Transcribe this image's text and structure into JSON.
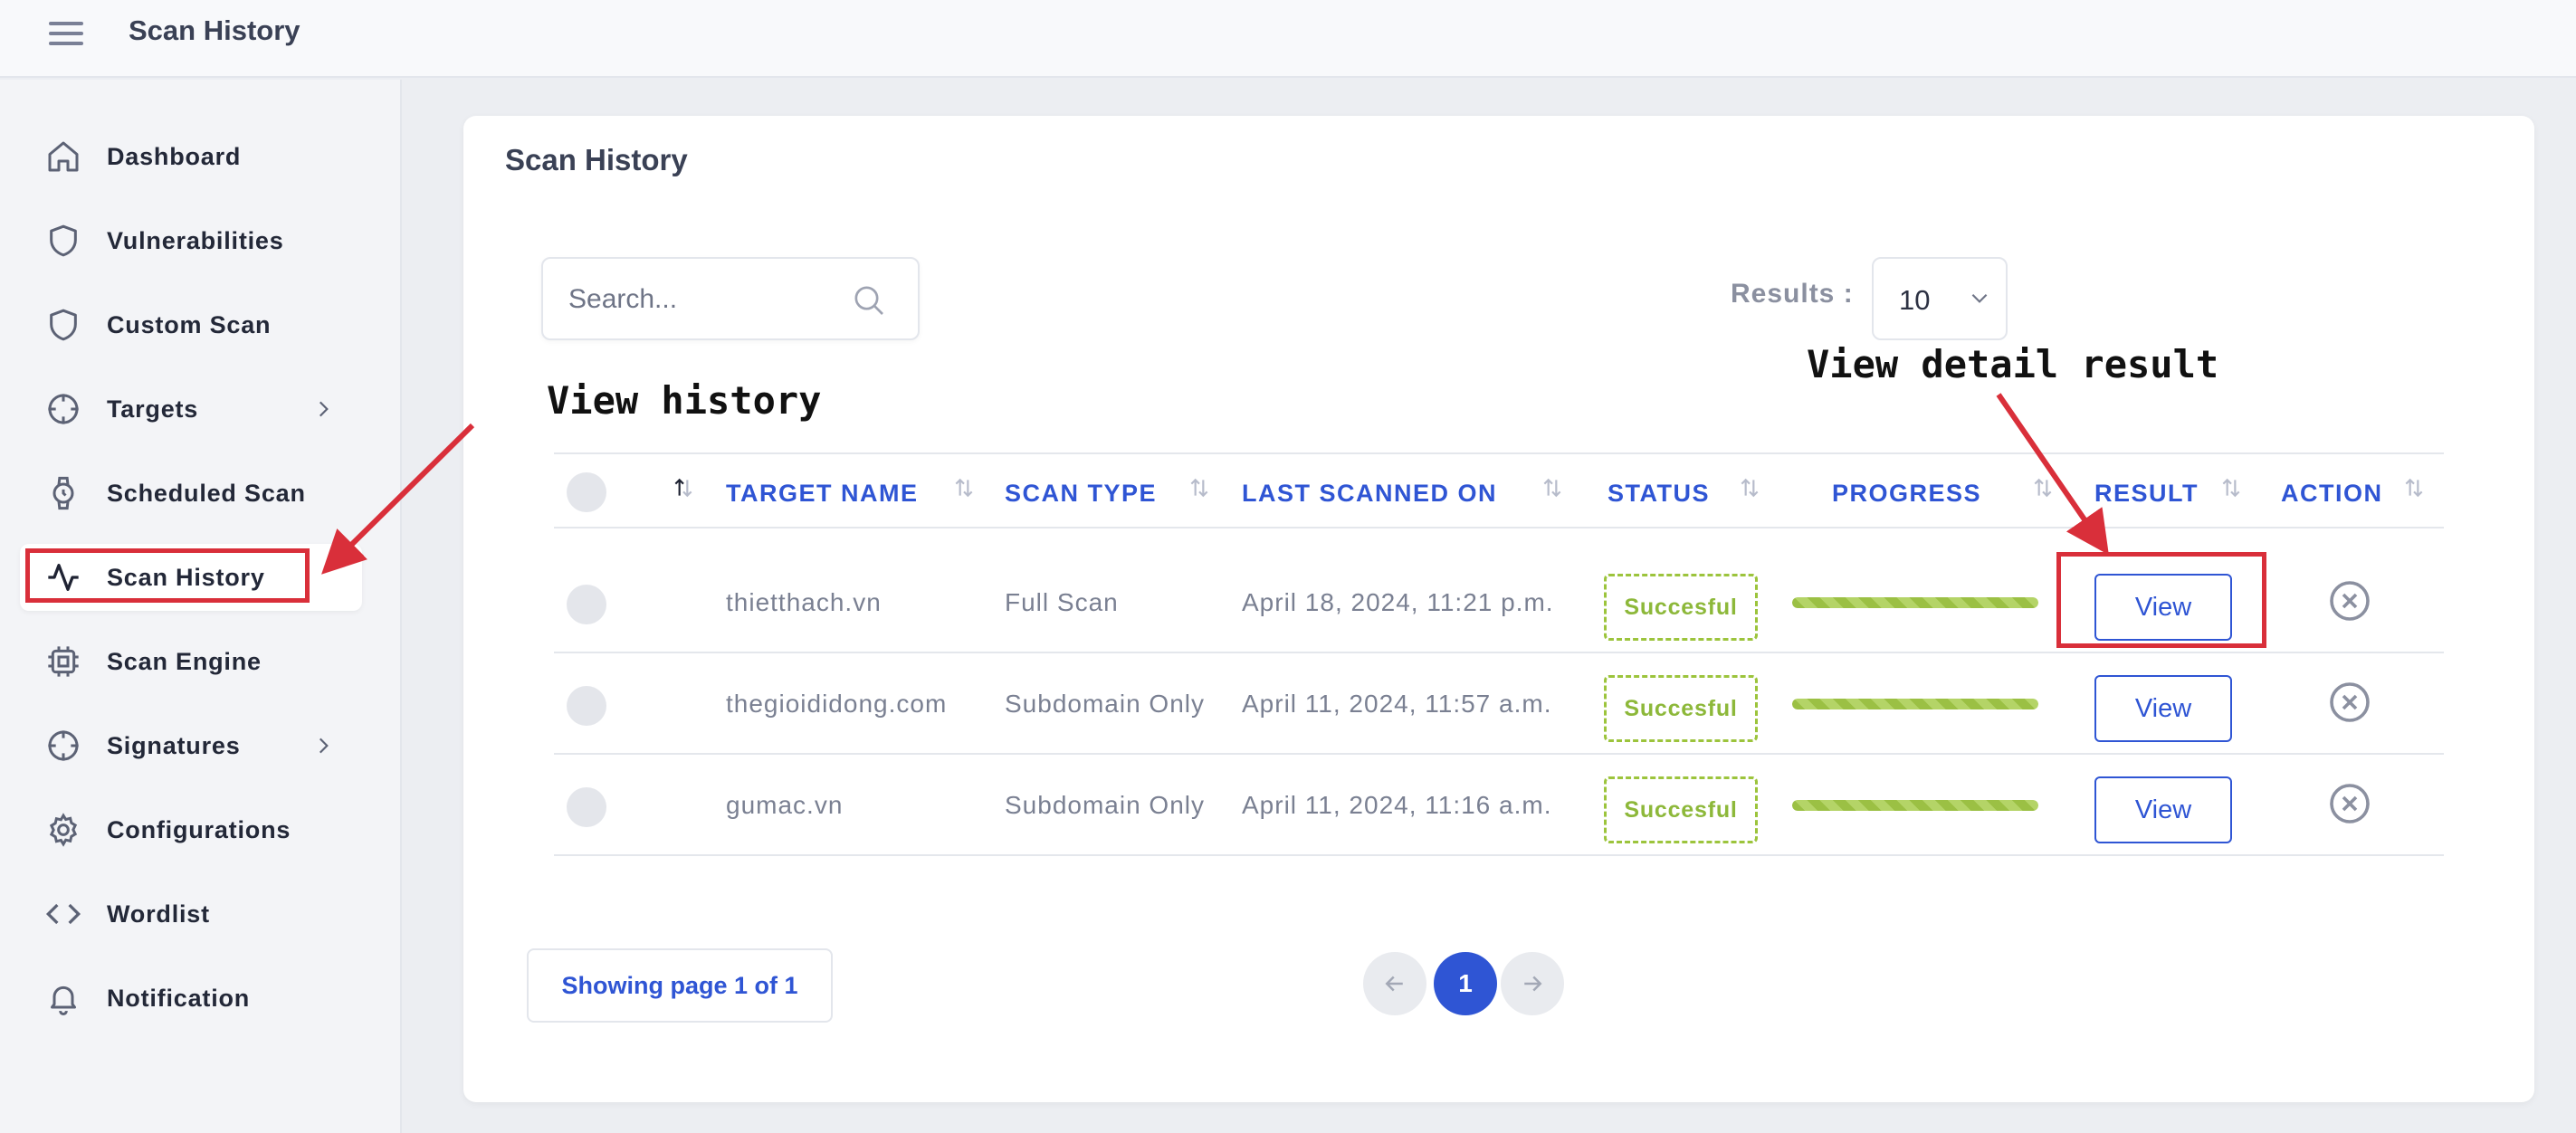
{
  "header": {
    "title": "Scan History"
  },
  "sidebar": {
    "items": [
      {
        "label": "Dashboard",
        "icon": "home-icon"
      },
      {
        "label": "Vulnerabilities",
        "icon": "shield-icon"
      },
      {
        "label": "Custom Scan",
        "icon": "shield-icon"
      },
      {
        "label": "Targets",
        "icon": "crosshair-icon"
      },
      {
        "label": "Scheduled Scan",
        "icon": "watch-icon"
      },
      {
        "label": "Scan History",
        "icon": "activity-icon"
      },
      {
        "label": "Scan Engine",
        "icon": "cpu-icon"
      },
      {
        "label": "Signatures",
        "icon": "crosshair-icon"
      },
      {
        "label": "Configurations",
        "icon": "gear-icon"
      },
      {
        "label": "Wordlist",
        "icon": "code-icon"
      },
      {
        "label": "Notification",
        "icon": "bell-icon"
      }
    ],
    "active": "Scan History"
  },
  "card": {
    "title": "Scan History"
  },
  "search": {
    "placeholder": "Search..."
  },
  "results": {
    "label": "Results :",
    "value": "10"
  },
  "annotations": {
    "history": "View history",
    "detail": "View detail result"
  },
  "table": {
    "columns": [
      "TARGET NAME",
      "SCAN TYPE",
      "LAST SCANNED ON",
      "STATUS",
      "PROGRESS",
      "RESULT",
      "ACTION"
    ],
    "rows": [
      {
        "target": "thietthach.vn",
        "scan_type": "Full Scan",
        "last_scanned": "April 18, 2024, 11:21 p.m.",
        "status": "Succesful",
        "progress": 1.0,
        "result": "View"
      },
      {
        "target": "thegioididong.com",
        "scan_type": "Subdomain Only",
        "last_scanned": "April 11, 2024, 11:57 a.m.",
        "status": "Succesful",
        "progress": 1.0,
        "result": "View"
      },
      {
        "target": "gumac.vn",
        "scan_type": "Subdomain Only",
        "last_scanned": "April 11, 2024, 11:16 a.m.",
        "status": "Succesful",
        "progress": 1.0,
        "result": "View"
      }
    ]
  },
  "pagination": {
    "info": "Showing page 1 of 1",
    "current": "1"
  },
  "colors": {
    "accent": "#2f55d4",
    "success": "#8db83a",
    "highlight": "#d92f3a"
  }
}
